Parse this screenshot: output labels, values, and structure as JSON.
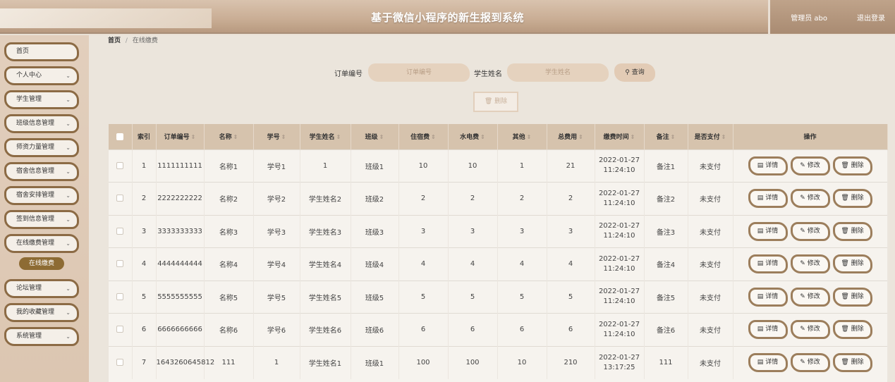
{
  "header": {
    "title": "基于微信小程序的新生报到系统",
    "user": "管理员 abo",
    "logout": "退出登录"
  },
  "sidebar": {
    "items": [
      {
        "label": "首页",
        "chevron": false
      },
      {
        "label": "个人中心",
        "chevron": true
      },
      {
        "label": "学生管理",
        "chevron": true
      },
      {
        "label": "班级信息管理",
        "chevron": true
      },
      {
        "label": "师资力量管理",
        "chevron": true
      },
      {
        "label": "宿舍信息管理",
        "chevron": true
      },
      {
        "label": "宿舍安排管理",
        "chevron": true
      },
      {
        "label": "签到信息管理",
        "chevron": true
      },
      {
        "label": "在线缴费管理",
        "chevron": true
      },
      {
        "label": "论坛管理",
        "chevron": true
      },
      {
        "label": "我的收藏管理",
        "chevron": true
      },
      {
        "label": "系统管理",
        "chevron": true
      }
    ],
    "active_sub": "在线缴费"
  },
  "breadcrumb": {
    "home": "首页",
    "sep": "/",
    "current": "在线缴费"
  },
  "search": {
    "order_label": "订单编号",
    "order_placeholder": "订单编号",
    "name_label": "学生姓名",
    "name_placeholder": "学生姓名",
    "query_label": "查询",
    "delete_label": "删除"
  },
  "table": {
    "headers": [
      "索引",
      "订单编号",
      "名称",
      "学号",
      "学生姓名",
      "班级",
      "住宿费",
      "水电费",
      "其他",
      "总费用",
      "缴费时间",
      "备注",
      "是否支付",
      "操作"
    ],
    "sortable": [
      false,
      true,
      true,
      true,
      true,
      true,
      true,
      true,
      true,
      true,
      true,
      true,
      true,
      false
    ],
    "actions": {
      "detail": "详情",
      "edit": "修改",
      "delete": "删除"
    },
    "rows": [
      {
        "index": "1",
        "order": "1111111111",
        "name": "名称1",
        "sid": "学号1",
        "student": "1",
        "cls": "班级1",
        "lodging": "10",
        "utility": "10",
        "other": "1",
        "total": "21",
        "date": "2022-01-27",
        "time": "11:24:10",
        "note": "备注1",
        "paid": "未支付"
      },
      {
        "index": "2",
        "order": "2222222222",
        "name": "名称2",
        "sid": "学号2",
        "student": "学生姓名2",
        "cls": "班级2",
        "lodging": "2",
        "utility": "2",
        "other": "2",
        "total": "2",
        "date": "2022-01-27",
        "time": "11:24:10",
        "note": "备注2",
        "paid": "未支付"
      },
      {
        "index": "3",
        "order": "3333333333",
        "name": "名称3",
        "sid": "学号3",
        "student": "学生姓名3",
        "cls": "班级3",
        "lodging": "3",
        "utility": "3",
        "other": "3",
        "total": "3",
        "date": "2022-01-27",
        "time": "11:24:10",
        "note": "备注3",
        "paid": "未支付"
      },
      {
        "index": "4",
        "order": "4444444444",
        "name": "名称4",
        "sid": "学号4",
        "student": "学生姓名4",
        "cls": "班级4",
        "lodging": "4",
        "utility": "4",
        "other": "4",
        "total": "4",
        "date": "2022-01-27",
        "time": "11:24:10",
        "note": "备注4",
        "paid": "未支付"
      },
      {
        "index": "5",
        "order": "5555555555",
        "name": "名称5",
        "sid": "学号5",
        "student": "学生姓名5",
        "cls": "班级5",
        "lodging": "5",
        "utility": "5",
        "other": "5",
        "total": "5",
        "date": "2022-01-27",
        "time": "11:24:10",
        "note": "备注5",
        "paid": "未支付"
      },
      {
        "index": "6",
        "order": "6666666666",
        "name": "名称6",
        "sid": "学号6",
        "student": "学生姓名6",
        "cls": "班级6",
        "lodging": "6",
        "utility": "6",
        "other": "6",
        "total": "6",
        "date": "2022-01-27",
        "time": "11:24:10",
        "note": "备注6",
        "paid": "未支付"
      },
      {
        "index": "7",
        "order": "1643260645812",
        "name": "111",
        "sid": "1",
        "student": "学生姓名1",
        "cls": "班级1",
        "lodging": "100",
        "utility": "100",
        "other": "10",
        "total": "210",
        "date": "2022-01-27",
        "time": "13:17:25",
        "note": "111",
        "paid": "未支付"
      }
    ]
  },
  "icons": {
    "search": "search-icon",
    "delete": "trash-icon",
    "detail": "document-icon",
    "edit": "pencil-icon",
    "chevron": "chevron-down-icon"
  }
}
